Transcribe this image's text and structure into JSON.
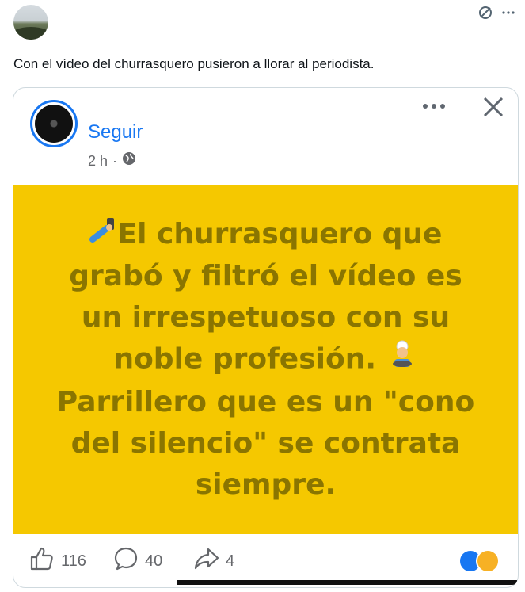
{
  "tweet": {
    "text": "Con el vídeo del churrasquero pusieron a llorar al periodista."
  },
  "post": {
    "follow_label": "Seguir",
    "time": "2 h",
    "time_sep": "·",
    "banner_lines": [
      "El churrasquero que",
      "grabó y filtró el vídeo es",
      "un irrespetuoso con su",
      "noble profesión.",
      "Parrillero que es un \"cono",
      "del silencio\" se contrata",
      "siempre."
    ],
    "banner_color": "#f5c800",
    "accent_color": "#1877f2",
    "likes": "116",
    "comments": "40",
    "shares": "4"
  },
  "icons": {
    "top_right_1": "slash-circle-icon",
    "top_right_2": "more-icon",
    "post_more": "more-horizontal-icon",
    "post_close": "close-icon",
    "globe": "globe-icon",
    "like": "thumbs-up-icon",
    "comment": "comment-icon",
    "share": "share-icon",
    "reactions": "reactions-icon"
  }
}
